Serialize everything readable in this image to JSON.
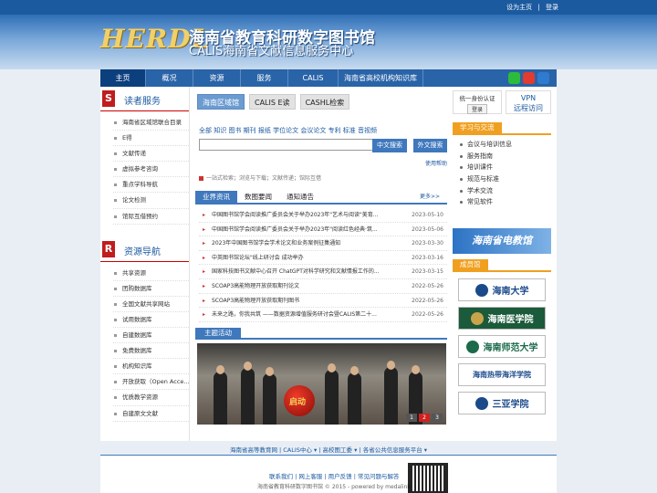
{
  "topbar": {
    "homepage": "设为主页",
    "separator": "|",
    "login": "登录"
  },
  "brand": {
    "logo_en": "HERDL",
    "title_cn": "海南省教育科研数字图书馆",
    "subtitle_cn": "CALIS海南省文献信息服务中心"
  },
  "nav": [
    "主页",
    "概况",
    "资源",
    "服务",
    "CALIS",
    "海南省高校机构知识库"
  ],
  "social": [
    {
      "icon": "wechat-icon",
      "color": "#2dbb3c"
    },
    {
      "icon": "weibo-icon",
      "color": "#e23b2f"
    },
    {
      "icon": "mail-icon",
      "color": "#2f7bd0"
    }
  ],
  "left": {
    "reader_section": {
      "badge": "S",
      "title": "读者服务",
      "items": [
        "海南省区域馆联合目录",
        "E得",
        "文献传递",
        "虚拟参考咨询",
        "重点学科导航",
        "论文检测",
        "馆际互借预约"
      ]
    },
    "resource_section": {
      "badge": "R",
      "title": "资源导航",
      "items": [
        "共享资源",
        "团购数据库",
        "全国文献共享网站",
        "试用数据库",
        "自建数据库",
        "免费数据库",
        "机构知识库",
        "开放获取（Open Acce...",
        "优质教学资源",
        "自建原文文献"
      ]
    }
  },
  "search": {
    "tabs": [
      "海南区域馆",
      "CALIS E读",
      "CASHL检索"
    ],
    "categories": "全部 知识 图书 期刊 报纸 学位论文 会议论文 专利 标准 音视频",
    "btn_cn": "中文搜索",
    "btn_foreign": "外文搜索",
    "help": "使用帮助",
    "note": "一站式检索；浏览与下载；文献传递；馆际互借"
  },
  "news": {
    "tabs": [
      "业界资讯",
      "数图要闻",
      "通知通告"
    ],
    "more": "更多>>",
    "items": [
      {
        "title": "中国图书馆学会阅读推广委员会关于举办2023年\"艺术与阅读\"美育...",
        "date": "2023-05-10"
      },
      {
        "title": "中国图书馆学会阅读推广委员会关于举办2023年\"阅读红色经典·筑...",
        "date": "2023-05-06"
      },
      {
        "title": "2023年中国图书馆学会学术论文和业务案例征集通知",
        "date": "2023-03-30"
      },
      {
        "title": "中英图书馆论坛\"线上研讨会 成功举办",
        "date": "2023-03-16"
      },
      {
        "title": "国家科技图书文献中心召开 ChatGPT对科学研究和文献情报工作的...",
        "date": "2023-03-15"
      },
      {
        "title": "SCOAP3高能物理开放获取期刊论文",
        "date": "2022-05-26"
      },
      {
        "title": "SCOAP3高能物理开放获取期刊图书",
        "date": "2022-05-26"
      },
      {
        "title": "未来之路，你我共筑 ——数据资源增值服务研讨会暨CALIS第二十...",
        "date": "2022-05-26"
      }
    ]
  },
  "theme": {
    "title": "主题活动",
    "ball_text": "启动",
    "pager": [
      "1",
      "2",
      "3"
    ],
    "active_page": 2
  },
  "right": {
    "login": {
      "text": "统一身份认证",
      "button": "登录"
    },
    "vpn": {
      "line1": "VPN",
      "line2": "远程访问"
    },
    "exchange": {
      "title": "学习与交流",
      "items": [
        "会议与培训信息",
        "服务指南",
        "培训课件",
        "规范与标准",
        "学术交流",
        "常见软件"
      ]
    },
    "edu_banner": "海南省电教馆",
    "members": {
      "title": "成员馆",
      "items": [
        {
          "name": "海南大学",
          "color": "#1b4a8a"
        },
        {
          "name": "海南医学院",
          "color": "#1b5a3a"
        },
        {
          "name": "海南师范大学",
          "color": "#1b6a4a"
        },
        {
          "name": "海南热带海洋学院",
          "color": "#1b4a8a"
        },
        {
          "name": "三亚学院",
          "color": "#1b4a8a"
        }
      ]
    }
  },
  "footer": {
    "links": "海南省高等教育网 | CALIS中心 ▾ | 高校图工委 ▾ | 各省公共信息服务平台 ▾",
    "line1": "联系我们 | 网上客服 | 用户反馈 | 常见问题与解答",
    "line2": "海南省教育科研数字图书馆 © 2015 - powered by medalink"
  }
}
